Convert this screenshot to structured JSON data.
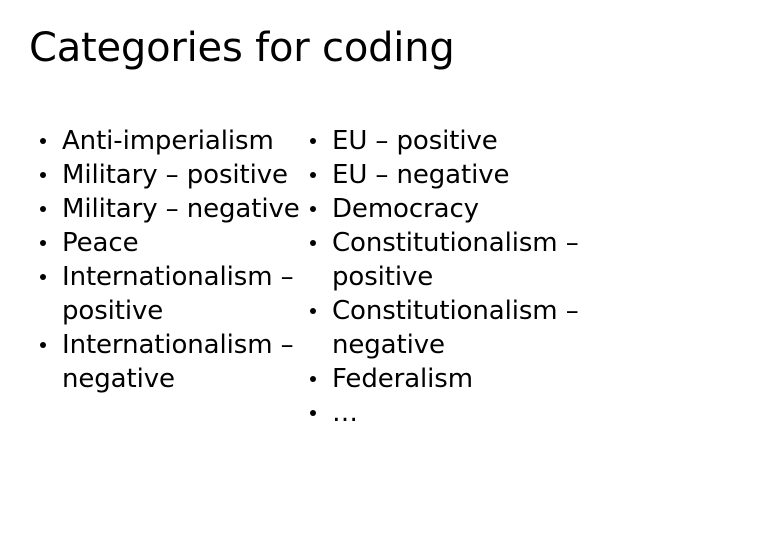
{
  "slide": {
    "title": "Categories for coding",
    "background_color": "#ffffff",
    "text_color": "#000000",
    "columns": [
      {
        "name": "left-column",
        "items": [
          "Anti-imperialism",
          "Military – positive",
          "Military – negative",
          "Peace",
          "Internationalism – positive",
          "Internationalism – negative"
        ]
      },
      {
        "name": "right-column",
        "items": [
          "EU – positive",
          "EU – negative",
          "Democracy",
          "Constitutionalism – positive",
          "Constitutionalism – negative",
          "Federalism",
          "…"
        ]
      }
    ]
  }
}
